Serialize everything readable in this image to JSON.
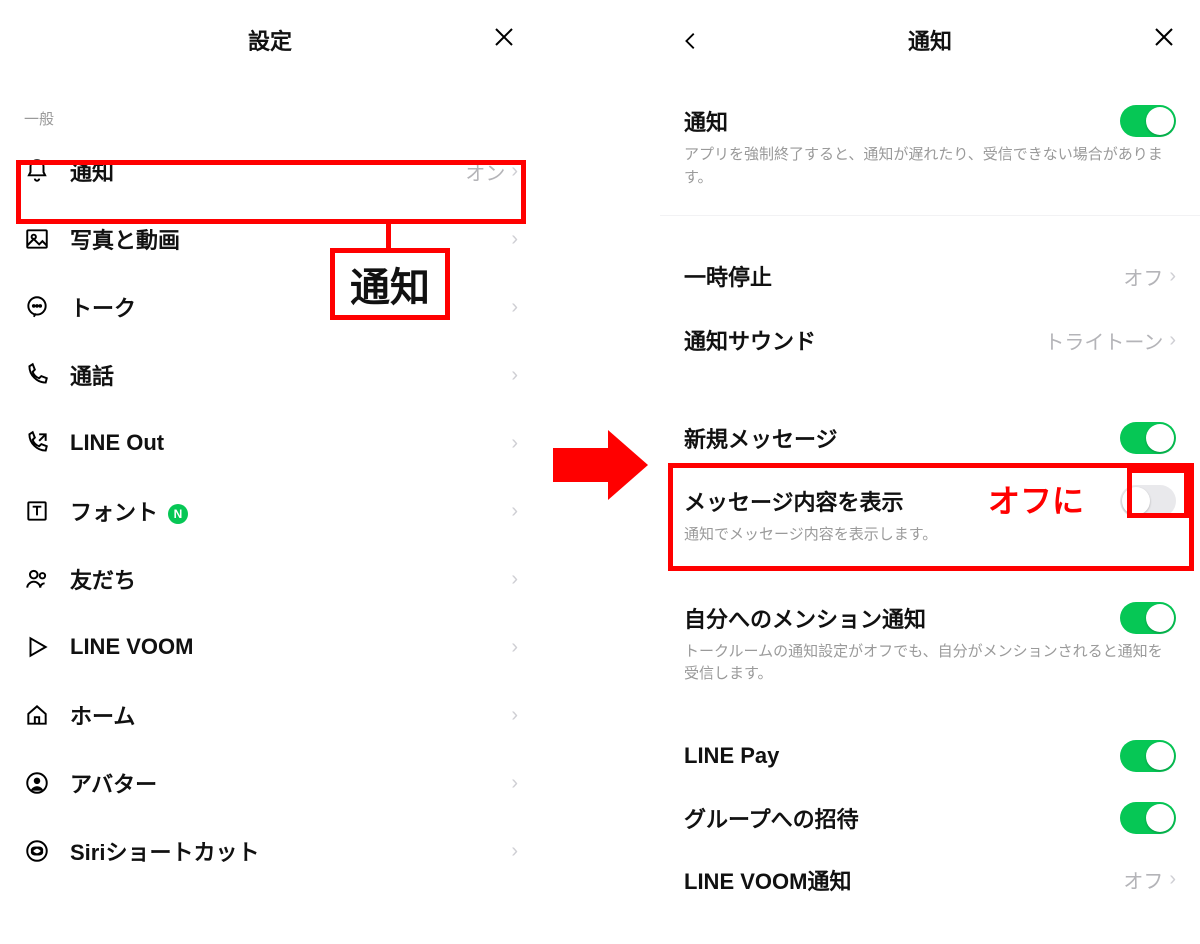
{
  "left": {
    "header": {
      "title": "設定",
      "close": "✕"
    },
    "section_general": "一般",
    "rows": {
      "notify": {
        "label": "通知",
        "value": "オン"
      },
      "photos": {
        "label": "写真と動画"
      },
      "talk": {
        "label": "トーク"
      },
      "call": {
        "label": "通話"
      },
      "lineout": {
        "label": "LINE Out"
      },
      "font": {
        "label": "フォント",
        "badge": "N"
      },
      "friends": {
        "label": "友だち"
      },
      "voom": {
        "label": "LINE VOOM"
      },
      "home": {
        "label": "ホーム"
      },
      "avatar": {
        "label": "アバター"
      },
      "siri": {
        "label": "Siriショートカット"
      }
    }
  },
  "right": {
    "header": {
      "title": "通知",
      "back": "‹",
      "close": "✕"
    },
    "rows": {
      "notifications": {
        "label": "通知",
        "desc": "アプリを強制終了すると、通知が遅れたり、受信できない場合があります。",
        "toggle": "on"
      },
      "pause": {
        "label": "一時停止",
        "value": "オフ"
      },
      "sound": {
        "label": "通知サウンド",
        "value": "トライトーン"
      },
      "newmsg": {
        "label": "新規メッセージ",
        "toggle": "on"
      },
      "showcontent": {
        "label": "メッセージ内容を表示",
        "desc": "通知でメッセージ内容を表示します。",
        "toggle": "off"
      },
      "mention": {
        "label": "自分へのメンション通知",
        "desc": "トークルームの通知設定がオフでも、自分がメンションされると通知を受信します。",
        "toggle": "on"
      },
      "linepay": {
        "label": "LINE Pay",
        "toggle": "on"
      },
      "groupinvite": {
        "label": "グループへの招待",
        "toggle": "on"
      },
      "voomnotify": {
        "label": "LINE VOOM通知",
        "value": "オフ"
      }
    }
  },
  "annotations": {
    "left_callout": "通知",
    "right_note": "オフに"
  }
}
